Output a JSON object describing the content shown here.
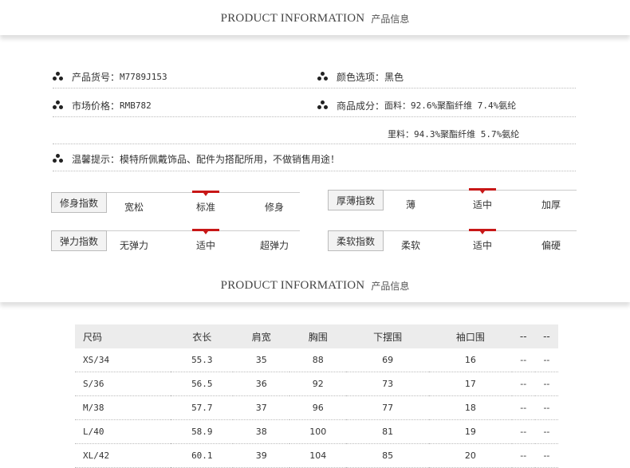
{
  "headers": {
    "title_en": "PRODUCT INFORMATION",
    "title_cn": "产品信息"
  },
  "info": {
    "sku_label": "产品货号：",
    "sku_value": "M7789J153",
    "color_label": "颜色选项：",
    "color_value": "黑色",
    "price_label": "市场价格：",
    "price_value": "RMB782",
    "material_label": "商品成分：",
    "material_outer": "面料：92.6%聚酯纤维 7.4%氨纶",
    "material_lining": "里料：94.3%聚酯纤维 5.7%氨纶",
    "note_label": "温馨提示：",
    "note_value": "模特所佩戴饰品、配件为搭配所用，不做销售用途！"
  },
  "scales": [
    {
      "tag": "修身指数",
      "options": [
        "宽松",
        "标准",
        "修身"
      ],
      "selected": 1
    },
    {
      "tag": "厚薄指数",
      "options": [
        "薄",
        "适中",
        "加厚"
      ],
      "selected": 1
    },
    {
      "tag": "弹力指数",
      "options": [
        "无弹力",
        "适中",
        "超弹力"
      ],
      "selected": 1
    },
    {
      "tag": "柔软指数",
      "options": [
        "柔软",
        "适中",
        "偏硬"
      ],
      "selected": 1
    }
  ],
  "size_table": {
    "headers": [
      "尺码",
      "衣长",
      "肩宽",
      "胸围",
      "下摆围",
      "袖口围",
      "--",
      "--"
    ],
    "rows": [
      [
        "XS/34",
        "55.3",
        "35",
        "88",
        "69",
        "16",
        "--",
        "--"
      ],
      [
        "S/36",
        "56.5",
        "36",
        "92",
        "73",
        "17",
        "--",
        "--"
      ],
      [
        "M/38",
        "57.7",
        "37",
        "96",
        "77",
        "18",
        "--",
        "--"
      ],
      [
        "L/40",
        "58.9",
        "38",
        "100",
        "81",
        "19",
        "--",
        "--"
      ],
      [
        "XL/42",
        "60.1",
        "39",
        "104",
        "85",
        "20",
        "--",
        "--"
      ]
    ]
  }
}
